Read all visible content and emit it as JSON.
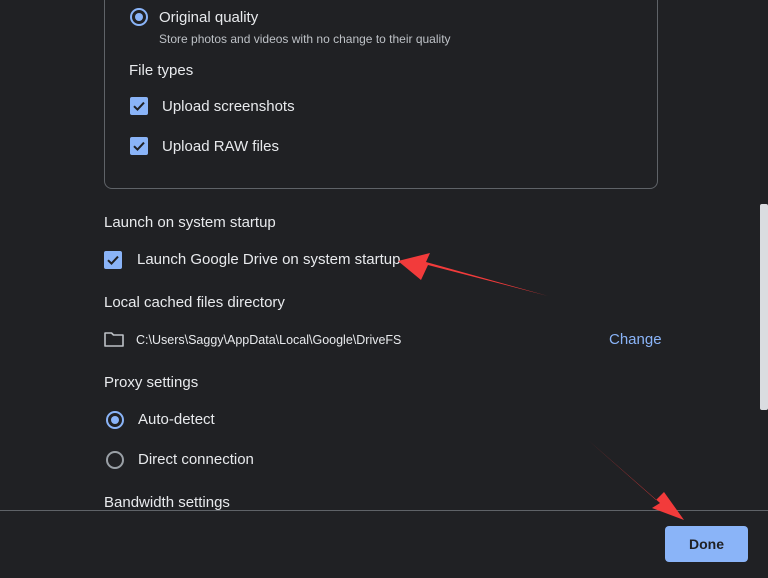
{
  "backup": {
    "quality_option_label": "Original quality",
    "quality_option_desc": "Store photos and videos with no change to their quality",
    "file_types_heading": "File types",
    "upload_screenshots_label": "Upload screenshots",
    "upload_raw_label": "Upload RAW files"
  },
  "startup": {
    "heading": "Launch on system startup",
    "checkbox_label": "Launch Google Drive on system startup"
  },
  "cache": {
    "heading": "Local cached files directory",
    "path": "C:\\Users\\Saggy\\AppData\\Local\\Google\\DriveFS",
    "change_label": "Change"
  },
  "proxy": {
    "heading": "Proxy settings",
    "auto_detect_label": "Auto-detect",
    "direct_label": "Direct connection",
    "selected": "Auto-detect"
  },
  "bandwidth": {
    "heading": "Bandwidth settings"
  },
  "footer": {
    "done_label": "Done"
  },
  "colors": {
    "background": "#202124",
    "accent": "#8ab4f8",
    "annotation_arrow": "#f23b3b"
  },
  "icons": [
    "radio-selected-icon",
    "checkbox-checked-icon",
    "folder-icon",
    "radio-unselected-icon",
    "annotation-arrow"
  ]
}
